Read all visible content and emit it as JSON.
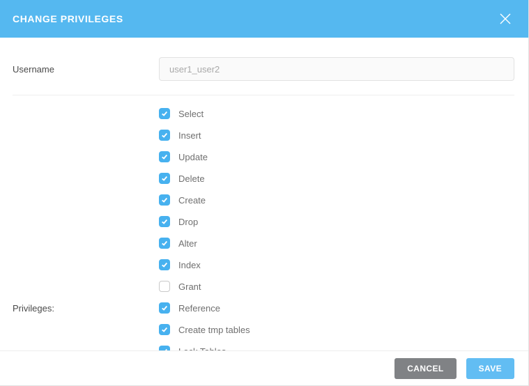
{
  "header": {
    "title": "CHANGE PRIVILEGES"
  },
  "form": {
    "username_label": "Username",
    "username_placeholder": "user1_user2",
    "privileges_label": "Privileges:"
  },
  "privileges": [
    {
      "label": "Select",
      "checked": true
    },
    {
      "label": "Insert",
      "checked": true
    },
    {
      "label": "Update",
      "checked": true
    },
    {
      "label": "Delete",
      "checked": true
    },
    {
      "label": "Create",
      "checked": true
    },
    {
      "label": "Drop",
      "checked": true
    },
    {
      "label": "Alter",
      "checked": true
    },
    {
      "label": "Index",
      "checked": true
    },
    {
      "label": "Grant",
      "checked": false
    },
    {
      "label": "Reference",
      "checked": true
    },
    {
      "label": "Create tmp tables",
      "checked": true
    },
    {
      "label": "Lock Tables",
      "checked": true
    }
  ],
  "footer": {
    "cancel": "CANCEL",
    "save": "SAVE"
  }
}
